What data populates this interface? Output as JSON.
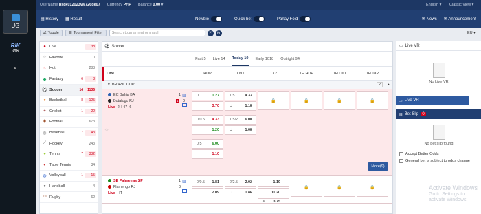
{
  "outer_nav": {
    "ug_label": "UG",
    "rk_label": "RiK",
    "igk_label": "IGK"
  },
  "topbar": {
    "username_label": "UserName",
    "username": "ps8k012023yw726de07",
    "currency_label": "Currency",
    "currency": "PHP",
    "balance_label": "Balance",
    "balance": "0.00",
    "language": "English",
    "view": "Classic View"
  },
  "navbar": {
    "history": "History",
    "result": "Result",
    "newbie": "Newbie",
    "quick_bet": "Quick bet",
    "parlay_fold": "Parlay Fold",
    "news": "News",
    "announcement": "Announcement",
    "region": "EU"
  },
  "filterbar": {
    "toggle": "Toggle",
    "tournament_filter": "Tournament Filter",
    "search_placeholder": "Search tournament or match"
  },
  "sidebar": {
    "items": [
      {
        "label": "Live",
        "live": "",
        "count": "38",
        "red": true,
        "icon": "live-icon",
        "glyph": "●",
        "color": "#d0021b"
      },
      {
        "label": "Favorite",
        "live": "",
        "count": "0",
        "red": false,
        "icon": "star-icon",
        "glyph": "☆",
        "color": "#888"
      },
      {
        "label": "Hot",
        "live": "",
        "count": "283",
        "red": false,
        "icon": "fire-icon",
        "glyph": "♨",
        "color": "#e55"
      },
      {
        "label": "Fantasy",
        "live": "6",
        "count": "8",
        "red": true,
        "icon": "fantasy-icon",
        "glyph": "◆",
        "color": "#2a6"
      },
      {
        "label": "Soccer",
        "live": "14",
        "count": "1136",
        "red": true,
        "icon": "soccer-icon",
        "glyph": "⚽",
        "color": "#333"
      },
      {
        "label": "Basketball",
        "live": "8",
        "count": "125",
        "red": true,
        "icon": "basketball-icon",
        "glyph": "●",
        "color": "#e27b21"
      },
      {
        "label": "Cricket",
        "live": "1",
        "count": "22",
        "red": true,
        "icon": "cricket-icon",
        "glyph": "✦",
        "color": "#a55"
      },
      {
        "label": "Football",
        "live": "",
        "count": "673",
        "red": false,
        "icon": "football-icon",
        "glyph": "⬮",
        "color": "#a0522d"
      },
      {
        "label": "Baseball",
        "live": "7",
        "count": "43",
        "red": true,
        "icon": "baseball-icon",
        "glyph": "◎",
        "color": "#555"
      },
      {
        "label": "Hockey",
        "live": "",
        "count": "243",
        "red": false,
        "icon": "hockey-icon",
        "glyph": "⟋",
        "color": "#555"
      },
      {
        "label": "Tennis",
        "live": "7",
        "count": "332",
        "red": true,
        "icon": "tennis-icon",
        "glyph": "●",
        "color": "#9c3"
      },
      {
        "label": "Table Tennis",
        "live": "",
        "count": "34",
        "red": false,
        "icon": "table-tennis-icon",
        "glyph": "◐",
        "color": "#c33"
      },
      {
        "label": "Volleyball",
        "live": "1",
        "count": "15",
        "red": true,
        "icon": "volleyball-icon",
        "glyph": "◍",
        "color": "#36c"
      },
      {
        "label": "Handball",
        "live": "",
        "count": "4",
        "red": false,
        "icon": "handball-icon",
        "glyph": "●",
        "color": "#555"
      },
      {
        "label": "Rugby",
        "live": "",
        "count": "62",
        "red": false,
        "icon": "rugby-icon",
        "glyph": "⬭",
        "color": "#a0522d"
      }
    ]
  },
  "main": {
    "sport_title": "Soccer",
    "tabs": [
      "Fast 5",
      "Live 14",
      "Today 10",
      "Early 1018",
      "Outright 94"
    ],
    "active_tab": "Today 10",
    "columns": {
      "live": "Live",
      "hdp": "HDP",
      "ou": "O/U",
      "x12": "1X2",
      "h1hdp": "1H HDP",
      "h1ou": "1H O/U",
      "h112": "1H 1X2"
    },
    "league": "BRAZIL CUP",
    "league_count": "2",
    "more_label": "More(9)",
    "match1": {
      "home": "EC Bahia BA",
      "away": "Botafogo RJ",
      "home_score": "1",
      "away_score": "0",
      "red_card": "1",
      "status": "Live",
      "time": "2H 47+6",
      "hdp": [
        {
          "h": "0",
          "ho": "1.27",
          "ao": "3.70"
        },
        {
          "h": "0/0.5",
          "ho": "4.33",
          "ao": "1.20"
        },
        {
          "h": "0.5",
          "ho": "6.00",
          "ao": "1.10"
        }
      ],
      "ou": [
        {
          "l": "1.5",
          "o": "4.33",
          "u_label": "U",
          "u": "1.18"
        },
        {
          "l": "1.5/2",
          "o": "6.00",
          "u_label": "U",
          "u": "1.08"
        }
      ]
    },
    "match2": {
      "home": "SE Palmeiras SP",
      "away": "Flamengo RJ",
      "home_score": "1",
      "away_score": "0",
      "status": "Live",
      "time": "HT",
      "hdp": [
        {
          "h": "0/0.5",
          "ho": "1.81",
          "ao": "2.09"
        }
      ],
      "ou": [
        {
          "l": "2/2.5",
          "o": "2.02",
          "u_label": "U",
          "u": "1.86"
        }
      ],
      "x12": {
        "home": "1.19",
        "away": "11.20",
        "draw_label": "X",
        "draw": "3.75"
      }
    }
  },
  "right": {
    "live_vr": "Live VR",
    "no_live_vr": "No Live VR",
    "live_vr_tab": "Live VR",
    "bet_slip": "Bet Slip",
    "bet_slip_count": "0",
    "no_bet_slip": "No bet slip found",
    "accept_better_odds": "Accept Better Odds",
    "general_bet": "General bet is subject to odds change"
  },
  "watermark": {
    "line1": "Activate Windows",
    "line2": "Go to Settings to activate Windows."
  }
}
